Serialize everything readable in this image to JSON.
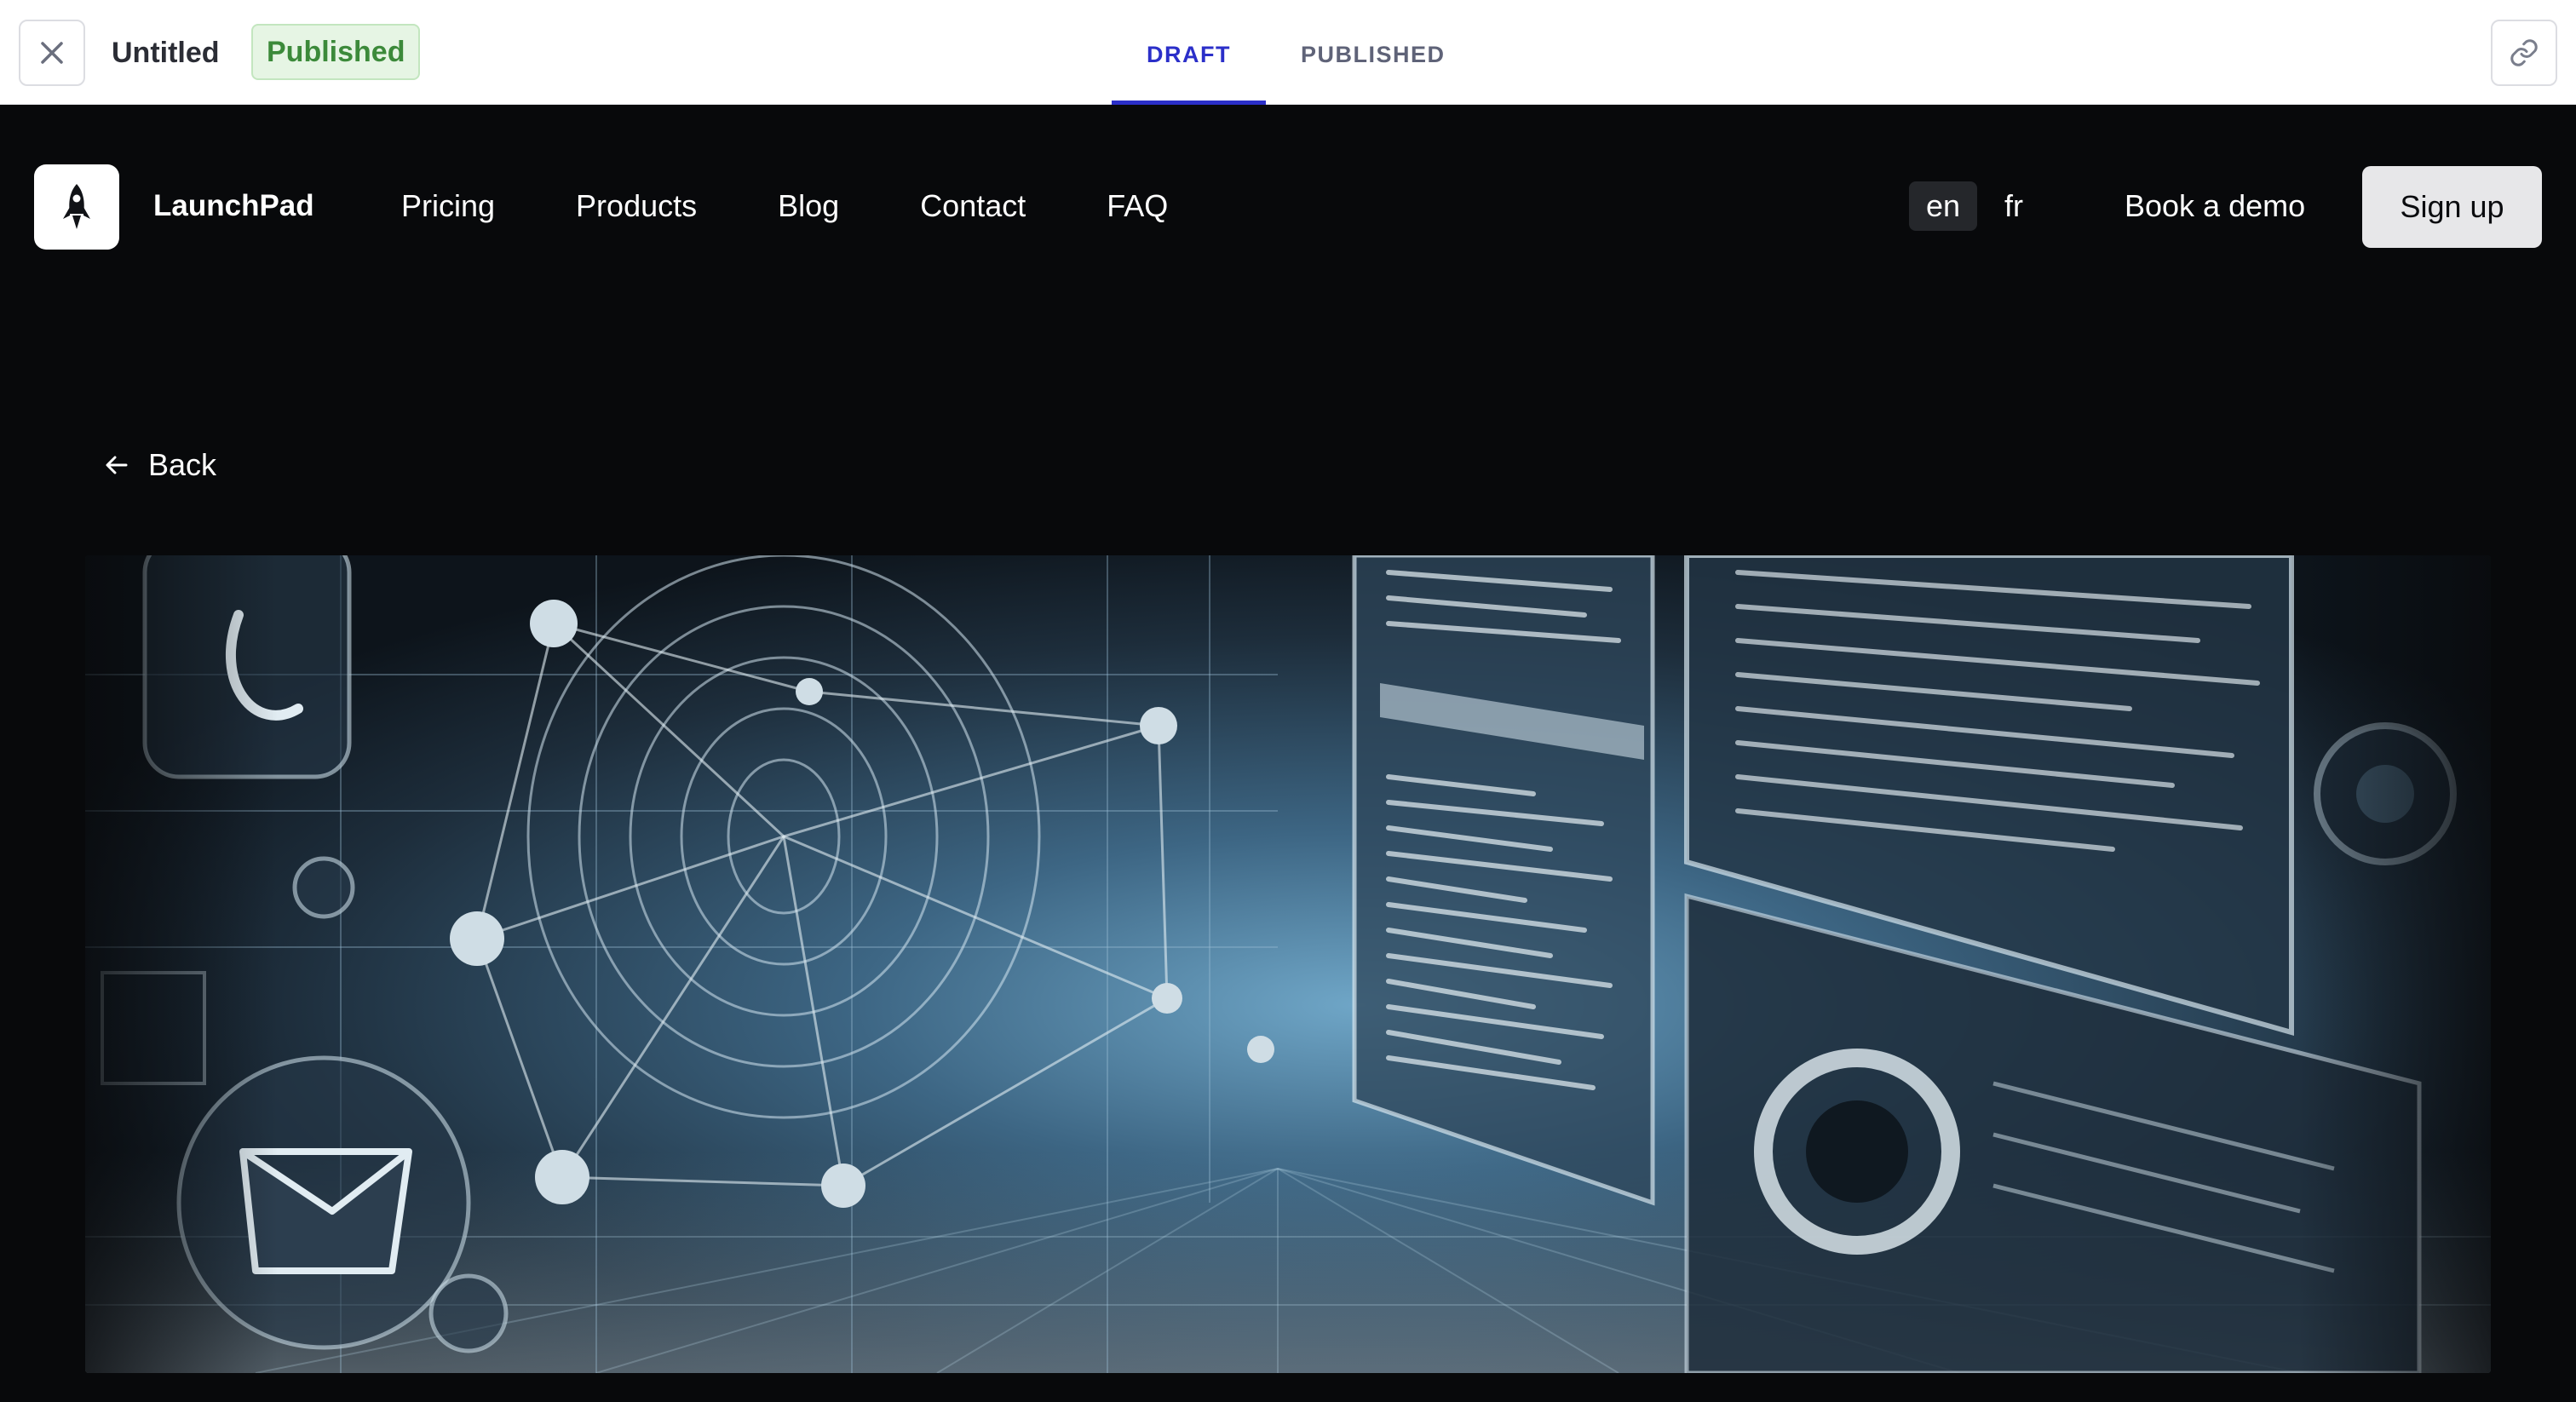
{
  "editor": {
    "doc_title": "Untitled",
    "status_badge": "Published",
    "tabs": [
      {
        "label": "DRAFT",
        "active": true
      },
      {
        "label": "PUBLISHED",
        "active": false
      }
    ],
    "icons": {
      "close": "close-icon",
      "link": "link-icon"
    },
    "accent_color": "#2b2fc9",
    "status_color": "#3c8a3a"
  },
  "site": {
    "brand": "LaunchPad",
    "logo_icon": "rocket-icon",
    "nav": [
      "Pricing",
      "Products",
      "Blog",
      "Contact",
      "FAQ"
    ],
    "languages": [
      {
        "code": "en",
        "active": true
      },
      {
        "code": "fr",
        "active": false
      }
    ],
    "book_demo": "Book a demo",
    "sign_up": "Sign up",
    "back": "Back",
    "back_icon": "arrow-left-icon",
    "hero_image": "futuristic-network-interface-illustration"
  }
}
